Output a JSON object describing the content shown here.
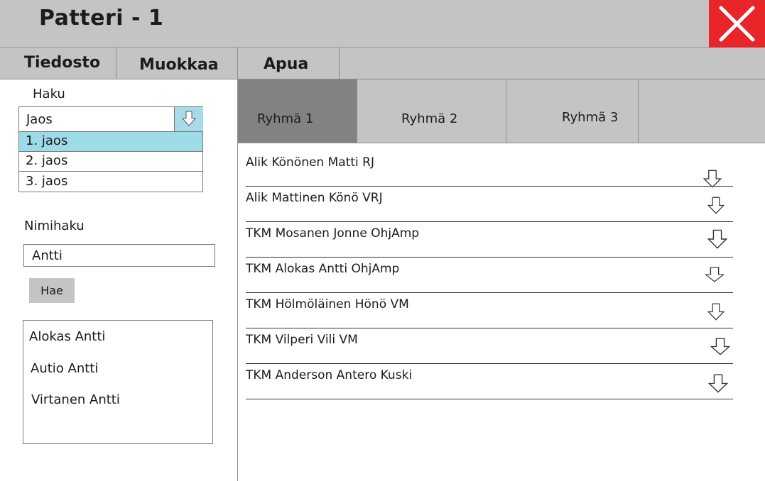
{
  "window": {
    "title": "Patteri - 1"
  },
  "menu": {
    "items": [
      "Tiedosto",
      "Muokkaa",
      "Apua"
    ]
  },
  "search": {
    "label": "Haku",
    "combo_value": "Jaos",
    "options": [
      "1. jaos",
      "2. jaos",
      "3. jaos"
    ],
    "selected_index": 0
  },
  "name_search": {
    "label": "Nimihaku",
    "input_value": "Antti",
    "button_label": "Hae",
    "results": [
      "Alokas Antti",
      "Autio Antti",
      "Virtanen Antti"
    ]
  },
  "tabs": {
    "items": [
      "Ryhmä 1",
      "Ryhmä 2",
      "Ryhmä 3"
    ],
    "active_index": 0
  },
  "members": [
    "Alik Könönen Matti RJ",
    "Alik Mattinen Könö VRJ",
    "TKM Mosanen Jonne OhjAmp",
    "TKM Alokas Antti OhjAmp",
    "TKM Hölmöläinen Hönö VM",
    "TKM Vilperi Vili VM",
    "TKM Anderson Antero Kuski"
  ],
  "colors": {
    "chrome": "#c4c4c4",
    "close": "#e8262a",
    "selection": "#9edbe9",
    "active_tab": "#828282"
  },
  "icons": {
    "close": "close-icon",
    "dropdown": "arrow-down-icon",
    "row_expand": "arrow-down-icon"
  }
}
